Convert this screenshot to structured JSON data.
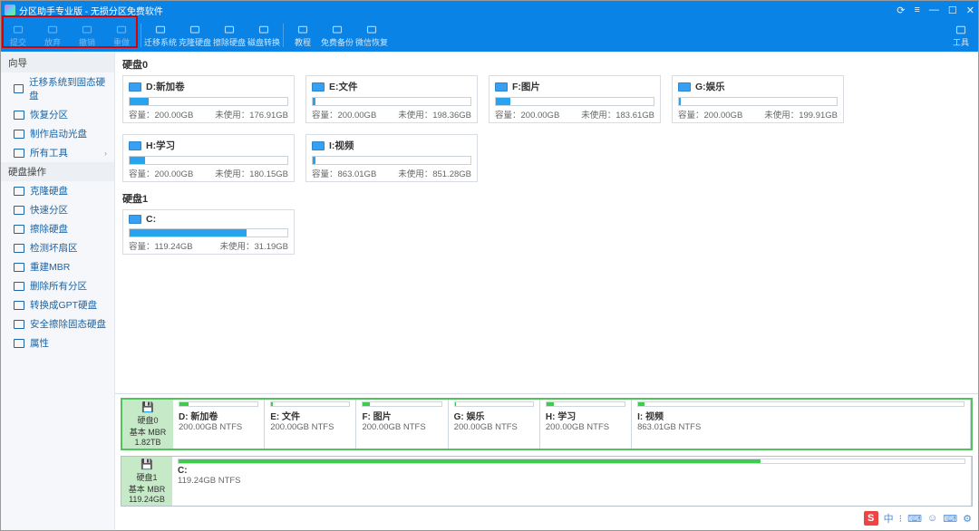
{
  "titlebar": {
    "title": "分区助手专业版 - 无损分区免费软件"
  },
  "windowctrl": {
    "refresh": "⟳",
    "menu": "≡",
    "min": "—",
    "max": "☐",
    "close": "✕"
  },
  "toolbar": {
    "g1": [
      {
        "name": "apply-icon",
        "label": "提交"
      },
      {
        "name": "discard-icon",
        "label": "放弃"
      },
      {
        "name": "undo-icon",
        "label": "撤销"
      },
      {
        "name": "redo-icon",
        "label": "重做"
      }
    ],
    "g2": [
      {
        "name": "migrate-icon",
        "label": "迁移系统"
      },
      {
        "name": "clone-icon",
        "label": "克隆硬盘"
      },
      {
        "name": "wipe-icon",
        "label": "擦除硬盘"
      },
      {
        "name": "convert-icon",
        "label": "磁盘转换"
      }
    ],
    "g3": [
      {
        "name": "tutorial-icon",
        "label": "教程"
      },
      {
        "name": "free-backup-icon",
        "label": "免费备份"
      },
      {
        "name": "wechat-recover-icon",
        "label": "微信恢复"
      }
    ],
    "tools_label": "工具"
  },
  "sidebar": {
    "group1": {
      "title": "向导",
      "items": [
        {
          "icon": "migrate-ssd-icon",
          "label": "迁移系统到固态硬盘"
        },
        {
          "icon": "recover-partition-icon",
          "label": "恢复分区"
        },
        {
          "icon": "boot-disc-icon",
          "label": "制作启动光盘"
        },
        {
          "icon": "all-tools-icon",
          "label": "所有工具",
          "chev": "›"
        }
      ]
    },
    "group2": {
      "title": "硬盘操作",
      "items": [
        {
          "icon": "clone-disk-icon",
          "label": "克隆硬盘"
        },
        {
          "icon": "quick-partition-icon",
          "label": "快速分区"
        },
        {
          "icon": "wipe-disk-icon",
          "label": "擦除硬盘"
        },
        {
          "icon": "check-bad-icon",
          "label": "检测坏扇区"
        },
        {
          "icon": "rebuild-mbr-icon",
          "label": "重建MBR"
        },
        {
          "icon": "delete-all-icon",
          "label": "删除所有分区"
        },
        {
          "icon": "to-gpt-icon",
          "label": "转换成GPT硬盘"
        },
        {
          "icon": "ssd-erase-icon",
          "label": "安全擦除固态硬盘"
        },
        {
          "icon": "properties-icon",
          "label": "属性"
        }
      ]
    }
  },
  "groups": [
    {
      "label": "硬盘0",
      "cards": [
        {
          "name": "D:新加卷",
          "cap": "容量：200.00GB",
          "free": "未使用：176.91GB",
          "pct": 12
        },
        {
          "name": "E:文件",
          "cap": "容量：200.00GB",
          "free": "未使用：198.36GB",
          "pct": 2
        },
        {
          "name": "F:图片",
          "cap": "容量：200.00GB",
          "free": "未使用：183.61GB",
          "pct": 9
        },
        {
          "name": "G:娱乐",
          "cap": "容量：200.00GB",
          "free": "未使用：199.91GB",
          "pct": 1
        },
        {
          "name": "H:学习",
          "cap": "容量：200.00GB",
          "free": "未使用：180.15GB",
          "pct": 10
        },
        {
          "name": "I:视频",
          "cap": "容量：863.01GB",
          "free": "未使用：851.28GB",
          "pct": 2
        }
      ]
    },
    {
      "label": "硬盘1",
      "cards": [
        {
          "name": "C:",
          "cap": "容量：119.24GB",
          "free": "未使用：31.19GB",
          "pct": 74
        }
      ]
    }
  ],
  "bottomDisks": [
    {
      "meta_line1": "硬盘0",
      "meta_line2": "基本 MBR",
      "meta_line3": "1.82TB",
      "selected": true,
      "parts": [
        {
          "name": "D: 新加卷",
          "sub": "200.00GB NTFS",
          "w": 11,
          "fill": 12
        },
        {
          "name": "E: 文件",
          "sub": "200.00GB NTFS",
          "w": 11,
          "fill": 2
        },
        {
          "name": "F: 图片",
          "sub": "200.00GB NTFS",
          "w": 11,
          "fill": 9
        },
        {
          "name": "G: 娱乐",
          "sub": "200.00GB NTFS",
          "w": 11,
          "fill": 1
        },
        {
          "name": "H: 学习",
          "sub": "200.00GB NTFS",
          "w": 11,
          "fill": 10
        },
        {
          "name": "I: 视频",
          "sub": "863.01GB NTFS",
          "w": 45,
          "fill": 2
        }
      ]
    },
    {
      "meta_line1": "硬盘1",
      "meta_line2": "基本 MBR",
      "meta_line3": "119.24GB",
      "selected": false,
      "parts": [
        {
          "name": "C:",
          "sub": "119.24GB NTFS",
          "w": 100,
          "fill": 74
        }
      ]
    }
  ],
  "tray": {
    "ime": "S",
    "t1": "中",
    "t2": "⁝",
    "t3": "⌨",
    "t4": "☺",
    "t5": "⌨",
    "t6": "⚙"
  }
}
